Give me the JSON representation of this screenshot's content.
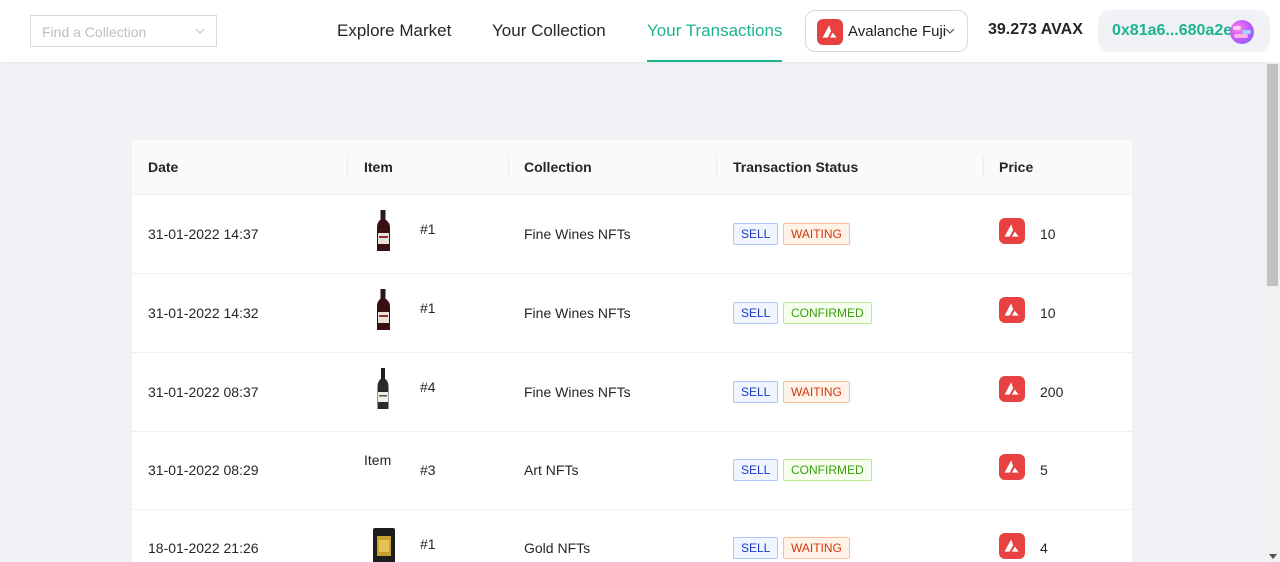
{
  "header": {
    "search_placeholder": "Find a Collection",
    "tabs": [
      {
        "label": "Explore Market",
        "active": false
      },
      {
        "label": "Your Collection",
        "active": false
      },
      {
        "label": "Your Transactions",
        "active": true
      }
    ],
    "network": {
      "label": "Avalanche Fuji",
      "icon": "avalanche-icon"
    },
    "balance": "39.273 AVAX",
    "wallet_address": "0x81a6...680a2e"
  },
  "colors": {
    "accent": "#1db38f",
    "avax_red": "#e84142",
    "sell_tag": "#1d39c4",
    "waiting_tag": "#d4380d",
    "confirmed_tag": "#389e0d"
  },
  "table": {
    "columns": [
      "Date",
      "Item",
      "Collection",
      "Transaction Status",
      "Price"
    ],
    "rows": [
      {
        "date": "31-01-2022 14:37",
        "item_id": "#1",
        "item_image": "wine-bottle",
        "collection": "Fine Wines NFTs",
        "type": "SELL",
        "status": "WAITING",
        "price": "10"
      },
      {
        "date": "31-01-2022 14:32",
        "item_id": "#1",
        "item_image": "wine-bottle",
        "collection": "Fine Wines NFTs",
        "type": "SELL",
        "status": "CONFIRMED",
        "price": "10"
      },
      {
        "date": "31-01-2022 08:37",
        "item_id": "#4",
        "item_image": "wine-bottle-light-label",
        "collection": "Fine Wines NFTs",
        "type": "SELL",
        "status": "WAITING",
        "price": "200"
      },
      {
        "date": "31-01-2022 08:29",
        "item_id": "#3",
        "item_image": "broken-image",
        "item_alt": "Item",
        "collection": "Art NFTs",
        "type": "SELL",
        "status": "CONFIRMED",
        "price": "5"
      },
      {
        "date": "18-01-2022 21:26",
        "item_id": "#1",
        "item_image": "gold-bar",
        "collection": "Gold NFTs",
        "type": "SELL",
        "status": "WAITING",
        "price": "4"
      }
    ]
  }
}
